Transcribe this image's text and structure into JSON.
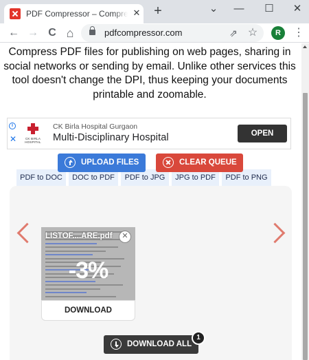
{
  "browser": {
    "tab_title": "PDF Compressor – Compress PDF",
    "tab_close": "✕",
    "new_tab": "+",
    "window_controls": {
      "dropdown": "⌄",
      "minimize": "—",
      "maximize": "☐",
      "close": "✕"
    },
    "nav": {
      "back": "←",
      "forward": "→",
      "reload": "C",
      "home": "⌂"
    },
    "url": "pdfcompressor.com",
    "share_icon": "⇗",
    "bookmark_icon": "☆",
    "profile_initial": "R",
    "menu_icon": "⋮"
  },
  "intro_text": "Compress PDF files for publishing on web pages, sharing in social networks or sending by email. Unlike other services this tool doesn't change the DPI, thus keeping your documents printable and zoomable.",
  "ad": {
    "info": "i",
    "close": "✕",
    "logo_text": "CK BIRLA HOSPITAL",
    "advertiser": "CK Birla Hospital Gurgaon",
    "headline": "Multi-Disciplinary Hospital",
    "cta": "OPEN"
  },
  "tool_tabs": [
    "PDF to DOC",
    "DOC to PDF",
    "PDF to JPG",
    "JPG to PDF",
    "PDF to PNG"
  ],
  "actions": {
    "upload": "UPLOAD FILES",
    "clear": "CLEAR QUEUE",
    "download_all": "DOWNLOAD ALL",
    "queue_count": "1"
  },
  "file": {
    "name": "LISTOF....ARE.pdf",
    "remove": "✕",
    "progress": "-3%",
    "download": "DOWNLOAD"
  },
  "colors": {
    "upload": "#3b7ad9",
    "clear": "#d9483b",
    "download_all": "#3a3a3a",
    "carousel_arrow": "#e07b6e",
    "tab_bg": "#e8f0fb"
  }
}
